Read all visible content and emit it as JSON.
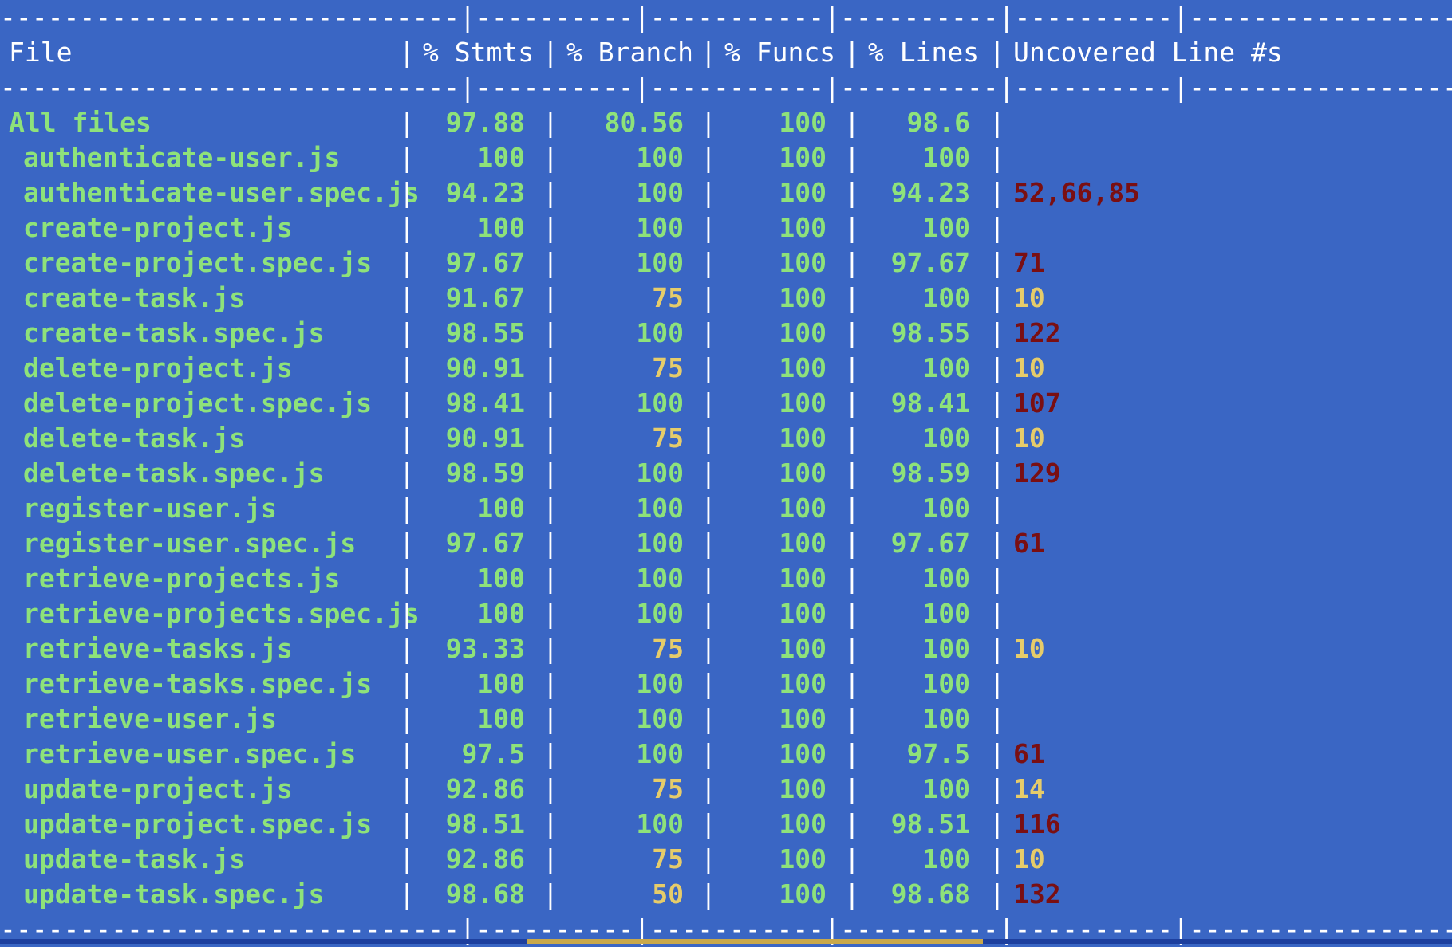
{
  "rule_line": "-----------------------------|----------|-----------|----------|----------|-------------------",
  "headers": {
    "file": "File",
    "stmts": "% Stmts",
    "branch": "% Branch",
    "funcs": "% Funcs",
    "lines": "% Lines",
    "uncovered": "Uncovered Line #s"
  },
  "separator": "|",
  "colors": {
    "background": "#3a66c4",
    "covered": "#8ee27a",
    "partial": "#e6cc6a",
    "uncovered": "#7a0f12"
  },
  "rows": [
    {
      "file": "All files",
      "stmts": "97.88",
      "branch": "80.56",
      "funcs": "100",
      "lines": "98.6",
      "uncovered": "",
      "branch_status": "green",
      "unc_status": "none",
      "indent": false
    },
    {
      "file": "authenticate-user.js",
      "stmts": "100",
      "branch": "100",
      "funcs": "100",
      "lines": "100",
      "uncovered": "",
      "branch_status": "green",
      "unc_status": "none",
      "indent": true
    },
    {
      "file": "authenticate-user.spec.js",
      "stmts": "94.23",
      "branch": "100",
      "funcs": "100",
      "lines": "94.23",
      "uncovered": "52,66,85",
      "branch_status": "green",
      "unc_status": "red",
      "indent": true
    },
    {
      "file": "create-project.js",
      "stmts": "100",
      "branch": "100",
      "funcs": "100",
      "lines": "100",
      "uncovered": "",
      "branch_status": "green",
      "unc_status": "none",
      "indent": true
    },
    {
      "file": "create-project.spec.js",
      "stmts": "97.67",
      "branch": "100",
      "funcs": "100",
      "lines": "97.67",
      "uncovered": "71",
      "branch_status": "green",
      "unc_status": "red",
      "indent": true
    },
    {
      "file": "create-task.js",
      "stmts": "91.67",
      "branch": "75",
      "funcs": "100",
      "lines": "100",
      "uncovered": "10",
      "branch_status": "yellow",
      "unc_status": "yellow",
      "indent": true
    },
    {
      "file": "create-task.spec.js",
      "stmts": "98.55",
      "branch": "100",
      "funcs": "100",
      "lines": "98.55",
      "uncovered": "122",
      "branch_status": "green",
      "unc_status": "red",
      "indent": true
    },
    {
      "file": "delete-project.js",
      "stmts": "90.91",
      "branch": "75",
      "funcs": "100",
      "lines": "100",
      "uncovered": "10",
      "branch_status": "yellow",
      "unc_status": "yellow",
      "indent": true
    },
    {
      "file": "delete-project.spec.js",
      "stmts": "98.41",
      "branch": "100",
      "funcs": "100",
      "lines": "98.41",
      "uncovered": "107",
      "branch_status": "green",
      "unc_status": "red",
      "indent": true
    },
    {
      "file": "delete-task.js",
      "stmts": "90.91",
      "branch": "75",
      "funcs": "100",
      "lines": "100",
      "uncovered": "10",
      "branch_status": "yellow",
      "unc_status": "yellow",
      "indent": true
    },
    {
      "file": "delete-task.spec.js",
      "stmts": "98.59",
      "branch": "100",
      "funcs": "100",
      "lines": "98.59",
      "uncovered": "129",
      "branch_status": "green",
      "unc_status": "red",
      "indent": true
    },
    {
      "file": "register-user.js",
      "stmts": "100",
      "branch": "100",
      "funcs": "100",
      "lines": "100",
      "uncovered": "",
      "branch_status": "green",
      "unc_status": "none",
      "indent": true
    },
    {
      "file": "register-user.spec.js",
      "stmts": "97.67",
      "branch": "100",
      "funcs": "100",
      "lines": "97.67",
      "uncovered": "61",
      "branch_status": "green",
      "unc_status": "red",
      "indent": true
    },
    {
      "file": "retrieve-projects.js",
      "stmts": "100",
      "branch": "100",
      "funcs": "100",
      "lines": "100",
      "uncovered": "",
      "branch_status": "green",
      "unc_status": "none",
      "indent": true
    },
    {
      "file": "retrieve-projects.spec.js",
      "stmts": "100",
      "branch": "100",
      "funcs": "100",
      "lines": "100",
      "uncovered": "",
      "branch_status": "green",
      "unc_status": "none",
      "indent": true
    },
    {
      "file": "retrieve-tasks.js",
      "stmts": "93.33",
      "branch": "75",
      "funcs": "100",
      "lines": "100",
      "uncovered": "10",
      "branch_status": "yellow",
      "unc_status": "yellow",
      "indent": true
    },
    {
      "file": "retrieve-tasks.spec.js",
      "stmts": "100",
      "branch": "100",
      "funcs": "100",
      "lines": "100",
      "uncovered": "",
      "branch_status": "green",
      "unc_status": "none",
      "indent": true
    },
    {
      "file": "retrieve-user.js",
      "stmts": "100",
      "branch": "100",
      "funcs": "100",
      "lines": "100",
      "uncovered": "",
      "branch_status": "green",
      "unc_status": "none",
      "indent": true
    },
    {
      "file": "retrieve-user.spec.js",
      "stmts": "97.5",
      "branch": "100",
      "funcs": "100",
      "lines": "97.5",
      "uncovered": "61",
      "branch_status": "green",
      "unc_status": "red",
      "indent": true
    },
    {
      "file": "update-project.js",
      "stmts": "92.86",
      "branch": "75",
      "funcs": "100",
      "lines": "100",
      "uncovered": "14",
      "branch_status": "yellow",
      "unc_status": "yellow",
      "indent": true
    },
    {
      "file": "update-project.spec.js",
      "stmts": "98.51",
      "branch": "100",
      "funcs": "100",
      "lines": "98.51",
      "uncovered": "116",
      "branch_status": "green",
      "unc_status": "red",
      "indent": true
    },
    {
      "file": "update-task.js",
      "stmts": "92.86",
      "branch": "75",
      "funcs": "100",
      "lines": "100",
      "uncovered": "10",
      "branch_status": "yellow",
      "unc_status": "yellow",
      "indent": true
    },
    {
      "file": "update-task.spec.js",
      "stmts": "98.68",
      "branch": "50",
      "funcs": "100",
      "lines": "98.68",
      "uncovered": "132",
      "branch_status": "yellow",
      "unc_status": "red",
      "indent": true
    }
  ]
}
